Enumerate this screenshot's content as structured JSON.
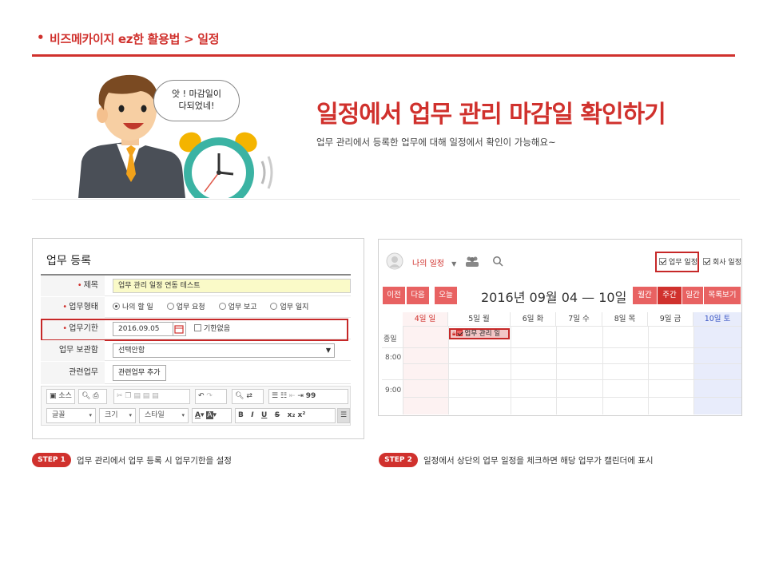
{
  "header": {
    "bullet": "•",
    "title": "비즈메카이지 ez한 활용법 > 일정"
  },
  "hero": {
    "bubble_line1": "앗 ! 마감일이",
    "bubble_line2": "다되었네!",
    "title": "일정에서 업무 관리 마감일 확인하기",
    "subtitle": "업무 관리에서 등록한 업무에 대해 일정에서 확인이 가능해요~"
  },
  "left_panel": {
    "title": "업무 등록",
    "rows": {
      "title_label": "제목",
      "title_value": "업무 관리 일정 연동 테스트",
      "type_label": "업무형태",
      "type_options": [
        "나의 할 일",
        "업무 요청",
        "업무 보고",
        "업무 일지"
      ],
      "deadline_label": "업무기한",
      "deadline_value": "2016.09.05",
      "no_deadline": "기한없음",
      "storage_label": "업무 보관함",
      "storage_value": "선택안함",
      "related_label": "관련업무",
      "related_button": "관련업무 추가"
    },
    "editor": {
      "source_label": "소스",
      "font_label": "글꼴",
      "size_label": "크기",
      "style_label": "스타일",
      "bold": "B",
      "italic": "I",
      "underline": "U",
      "strike": "S",
      "sub": "x₂",
      "sup": "x²",
      "color_a": "A",
      "quote": "99"
    }
  },
  "right_panel": {
    "my_schedule": "나의 일정",
    "filter_work": "업무 일정",
    "filter_company": "회사 일정",
    "btn_prev": "이전",
    "btn_next": "다음",
    "btn_today": "오늘",
    "date_range": "2016년 09월 04 — 10일",
    "view_month": "월간",
    "view_week": "주간",
    "view_day": "일간",
    "view_list": "목록보기",
    "days": [
      "4일 일",
      "5일 월",
      "6일 화",
      "7일 수",
      "8일 목",
      "9일 금",
      "10일 토"
    ],
    "allday_label": "종일",
    "event_label": "업무 관리 일",
    "time_8": "8:00",
    "time_9": "9:00"
  },
  "steps": {
    "step1_badge": "STEP 1",
    "step1_text": "업무 관리에서 업무 등록 시 업무기한을 설정",
    "step2_badge": "STEP 2",
    "step2_text": "일정에서 상단의 업무 일정을 체크하면 해당 업무가 캘린더에 표시"
  },
  "colors": {
    "accent": "#d0312d",
    "button": "#e86262",
    "saturday": "#e8ecfb",
    "sunday": "#fdf2f2",
    "title_field": "#fafac8"
  }
}
